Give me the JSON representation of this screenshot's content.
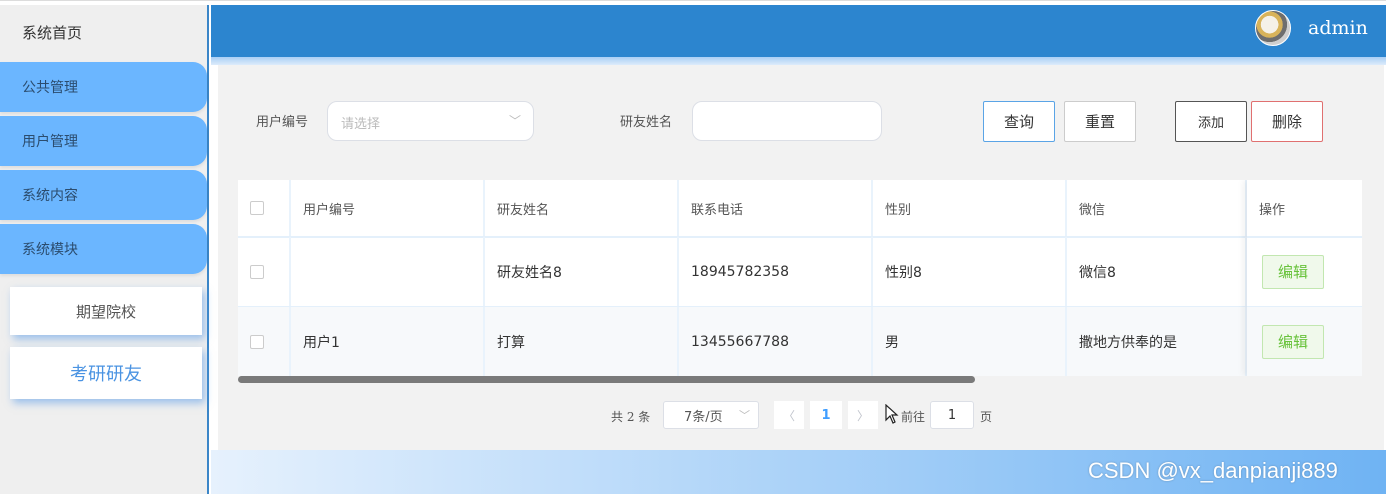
{
  "sidebar": {
    "home": "系统首页",
    "items": [
      {
        "label": "公共管理"
      },
      {
        "label": "用户管理"
      },
      {
        "label": "系统内容"
      },
      {
        "label": "系统模块"
      }
    ],
    "subitems": [
      {
        "label": "期望院校"
      },
      {
        "label": "考研研友"
      }
    ]
  },
  "header": {
    "username": "admin",
    "accent": "#2c85cf"
  },
  "filters": {
    "user_id_label": "用户编号",
    "user_id_placeholder": "请选择",
    "name_label": "研友姓名",
    "name_value": ""
  },
  "buttons": {
    "query": "查询",
    "reset": "重置",
    "add": "添加",
    "delete": "删除"
  },
  "table": {
    "headers": [
      "用户编号",
      "研友姓名",
      "联系电话",
      "性别",
      "微信",
      "操作"
    ],
    "rows": [
      {
        "user_id": "",
        "name": "研友姓名8",
        "phone": "18945782358",
        "gender": "性别8",
        "wechat": "微信8",
        "action": "编辑"
      },
      {
        "user_id": "用户1",
        "name": "打算",
        "phone": "13455667788",
        "gender": "男",
        "wechat": "撒地方供奉的是",
        "action": "编辑"
      }
    ]
  },
  "pagination": {
    "total": "共 2 条",
    "page_size": "7条/页",
    "current_page": "1",
    "goto_label": "前往",
    "goto_value": "1",
    "goto_suffix": "页"
  },
  "watermark": "CSDN @vx_danpianji889"
}
